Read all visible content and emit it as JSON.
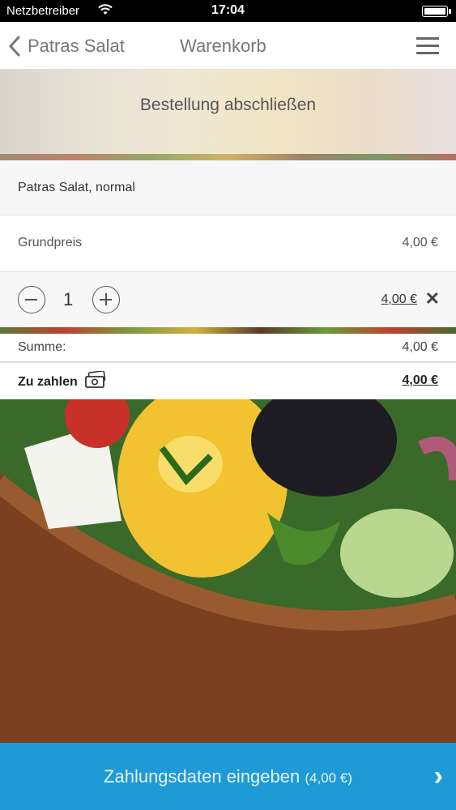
{
  "status_bar": {
    "carrier": "Netzbetreiber",
    "time": "17:04"
  },
  "nav": {
    "back_label": "Patras Salat",
    "title": "Warenkorb"
  },
  "heading": "Bestellung abschließen",
  "cart": {
    "item_name": "Patras Salat, normal",
    "base_price_label": "Grundpreis",
    "base_price_value": "4,00 €",
    "quantity": "1",
    "line_total": "4,00 €"
  },
  "summary": {
    "sum_label": "Summe:",
    "sum_value": "4,00 €",
    "pay_label": "Zu zahlen",
    "pay_value": "4,00 €"
  },
  "cta": {
    "label": "Zahlungsdaten eingeben",
    "amount": "(4,00 €)"
  },
  "colors": {
    "accent": "#1e9ad7"
  }
}
